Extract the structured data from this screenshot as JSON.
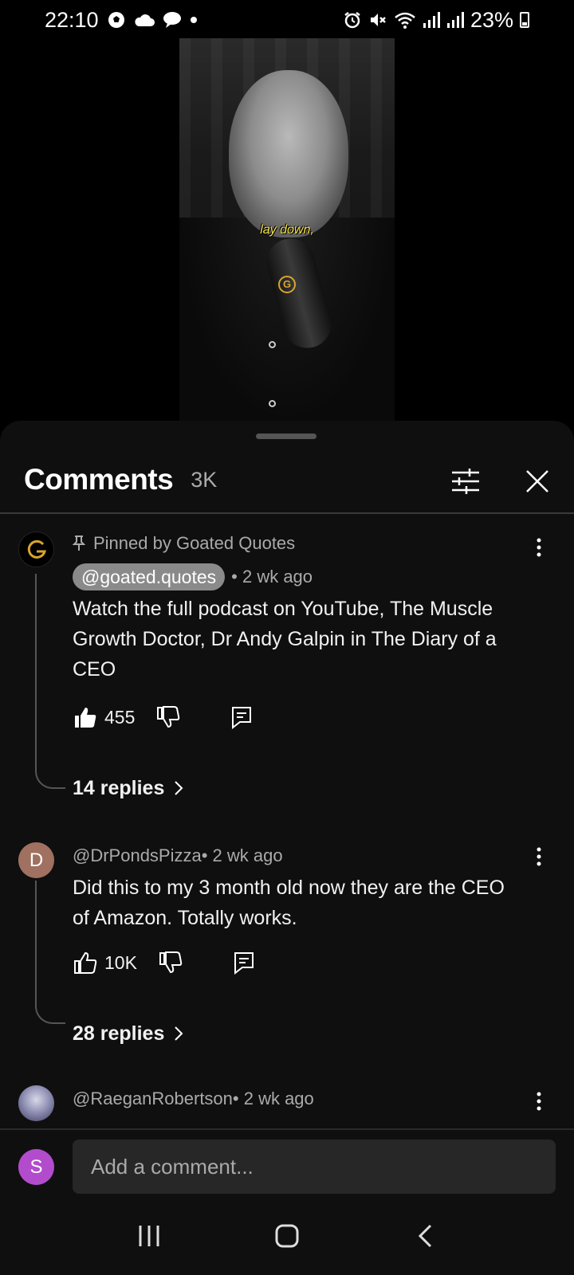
{
  "status_bar": {
    "time": "22:10",
    "battery": "23%"
  },
  "video": {
    "caption": "lay down,",
    "watermark": "G"
  },
  "panel": {
    "title": "Comments",
    "count": "3K"
  },
  "comments": [
    {
      "avatar_letter": "G",
      "avatar_color": "#000000",
      "pinned_label": "Pinned by Goated Quotes",
      "author": "@goated.quotes",
      "time": "• 2 wk ago",
      "text": "Watch the full podcast on YouTube, The Muscle Growth Doctor, Dr Andy Galpin in The Diary of a CEO",
      "likes": "455",
      "liked": true,
      "replies": "14 replies"
    },
    {
      "avatar_letter": "D",
      "avatar_color": "#a07060",
      "author": "@DrPondsPizza",
      "time": " • 2 wk ago",
      "text": "Did this to my 3 month old now they are the CEO of Amazon. Totally works.",
      "likes": "10K",
      "liked": false,
      "replies": "28 replies"
    },
    {
      "author": "@RaeganRobertson",
      "time": " • 2 wk ago"
    }
  ],
  "input": {
    "avatar_letter": "S",
    "placeholder": "Add a comment..."
  }
}
